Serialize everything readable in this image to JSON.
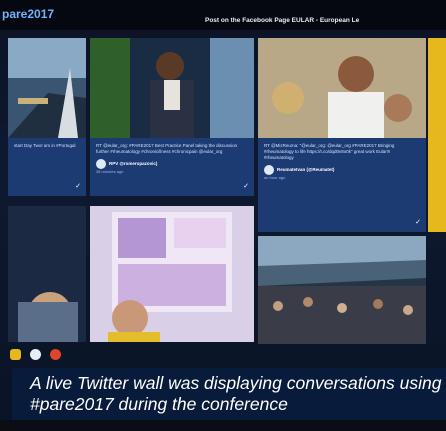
{
  "wall": {
    "hashtag": "pare2017",
    "banner": "Post on the Facebook Page EULAR - European Le"
  },
  "tiles": {
    "left_top": {
      "text": "start Day Two! am in #Portugal"
    },
    "speaker": {
      "text": "RT @eular_org: #PARE2017 Best Practice Panel taking the discussion further #rheumatology #chronicillness #chronicpain @eular_org",
      "author": "RPV @romeropazovic)",
      "time": "38 minutes ago"
    },
    "selfie": {
      "text": "RT @MizReuma: \"@eular_org: @eular_org #PARE2017 Bringing #rheumatology to life https://t.co/dqd0v8o0k\" great work Eular!!! #rheumatology",
      "author": "Reumatetvan (@Reumatet)",
      "time": "an hour ago"
    }
  },
  "caption": {
    "text": "A live Twitter wall was displaying conversations using #pare2017 during the conference"
  },
  "colors": {
    "caption_bg": "#0a1c3c",
    "tile_meta": "#1c3b73",
    "accent_yellow": "#e6b81c"
  }
}
